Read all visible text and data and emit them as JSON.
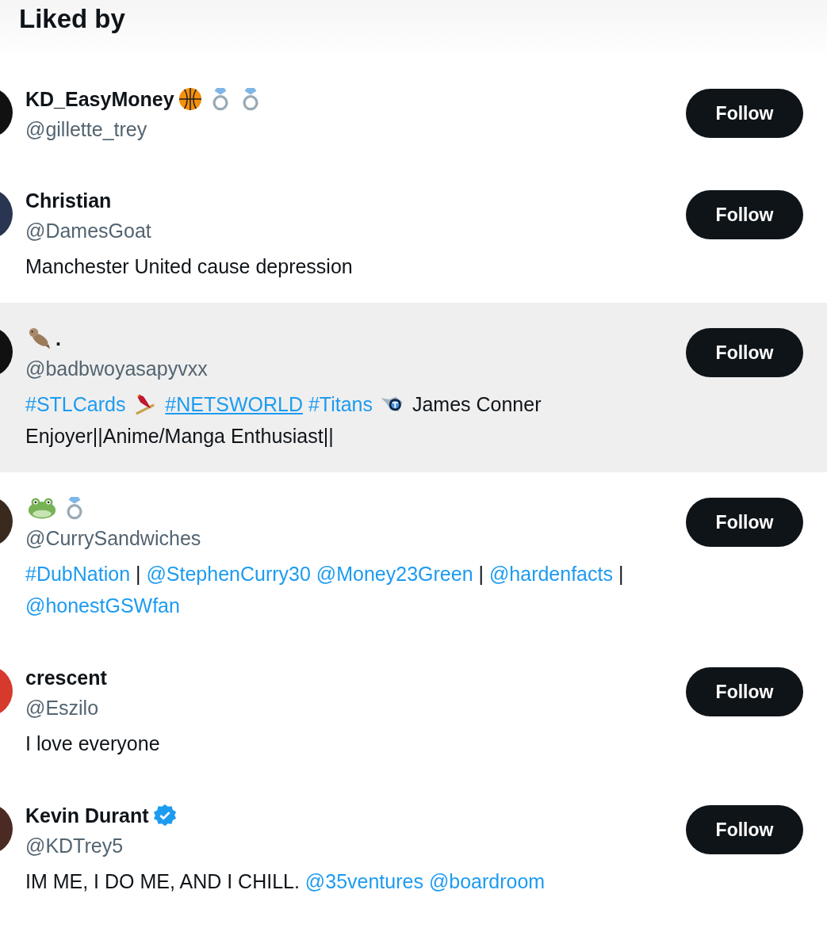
{
  "title": "Liked by",
  "users": [
    {
      "color": "#111111",
      "highlighted": false,
      "name": [
        {
          "kind": "text",
          "text": "KD_EasyMoney"
        },
        {
          "kind": "basketball"
        },
        {
          "kind": "ring"
        },
        {
          "kind": "ring"
        }
      ],
      "handle": "@gillette_trey",
      "button": "Follow"
    },
    {
      "color": "#2a3552",
      "highlighted": false,
      "name": [
        {
          "kind": "text",
          "text": "Christian"
        }
      ],
      "handle": "@DamesGoat",
      "button": "Follow",
      "bio": [
        {
          "kind": "text",
          "text": "Manchester United cause depression"
        }
      ]
    },
    {
      "color": "#111111",
      "highlighted": true,
      "name": [
        {
          "kind": "otter"
        },
        {
          "kind": "text",
          "text": "."
        }
      ],
      "handle": "@badbwoyasapyvxx",
      "button": "Follow",
      "bio": [
        {
          "kind": "link",
          "text": "#STLCards"
        },
        {
          "kind": "cardinal"
        },
        {
          "kind": "link-hover",
          "text": "#NETSWORLD"
        },
        {
          "kind": "link",
          "text": "#Titans"
        },
        {
          "kind": "titans"
        },
        {
          "kind": "text",
          "text": "James Conner Enjoyer||Anime/Manga Enthusiast||"
        }
      ]
    },
    {
      "color": "#3a2a1e",
      "highlighted": false,
      "name": [
        {
          "kind": "frog"
        },
        {
          "kind": "ring"
        }
      ],
      "handle": "@CurrySandwiches",
      "button": "Follow",
      "bio": [
        {
          "kind": "link",
          "text": "#DubNation"
        },
        {
          "kind": "text",
          "text": "|"
        },
        {
          "kind": "link",
          "text": "@StephenCurry30"
        },
        {
          "kind": "link",
          "text": "@Money23Green"
        },
        {
          "kind": "text",
          "text": "|"
        },
        {
          "kind": "link",
          "text": "@hardenfacts"
        },
        {
          "kind": "text",
          "text": "|"
        },
        {
          "kind": "link",
          "text": "@honestGSWfan"
        }
      ]
    },
    {
      "color": "#d63a2c",
      "highlighted": false,
      "name": [
        {
          "kind": "text",
          "text": "crescent"
        }
      ],
      "handle": "@Eszilo",
      "button": "Follow",
      "bio": [
        {
          "kind": "text",
          "text": "I love everyone"
        }
      ]
    },
    {
      "color": "#4a2a22",
      "highlighted": false,
      "name": [
        {
          "kind": "text",
          "text": "Kevin Durant"
        },
        {
          "kind": "verified"
        }
      ],
      "handle": "@KDTrey5",
      "button": "Follow",
      "bio": [
        {
          "kind": "text",
          "text": "IM ME, I DO ME, AND I CHILL."
        },
        {
          "kind": "link",
          "text": "@35ventures"
        },
        {
          "kind": "link",
          "text": "@boardroom"
        }
      ]
    }
  ]
}
